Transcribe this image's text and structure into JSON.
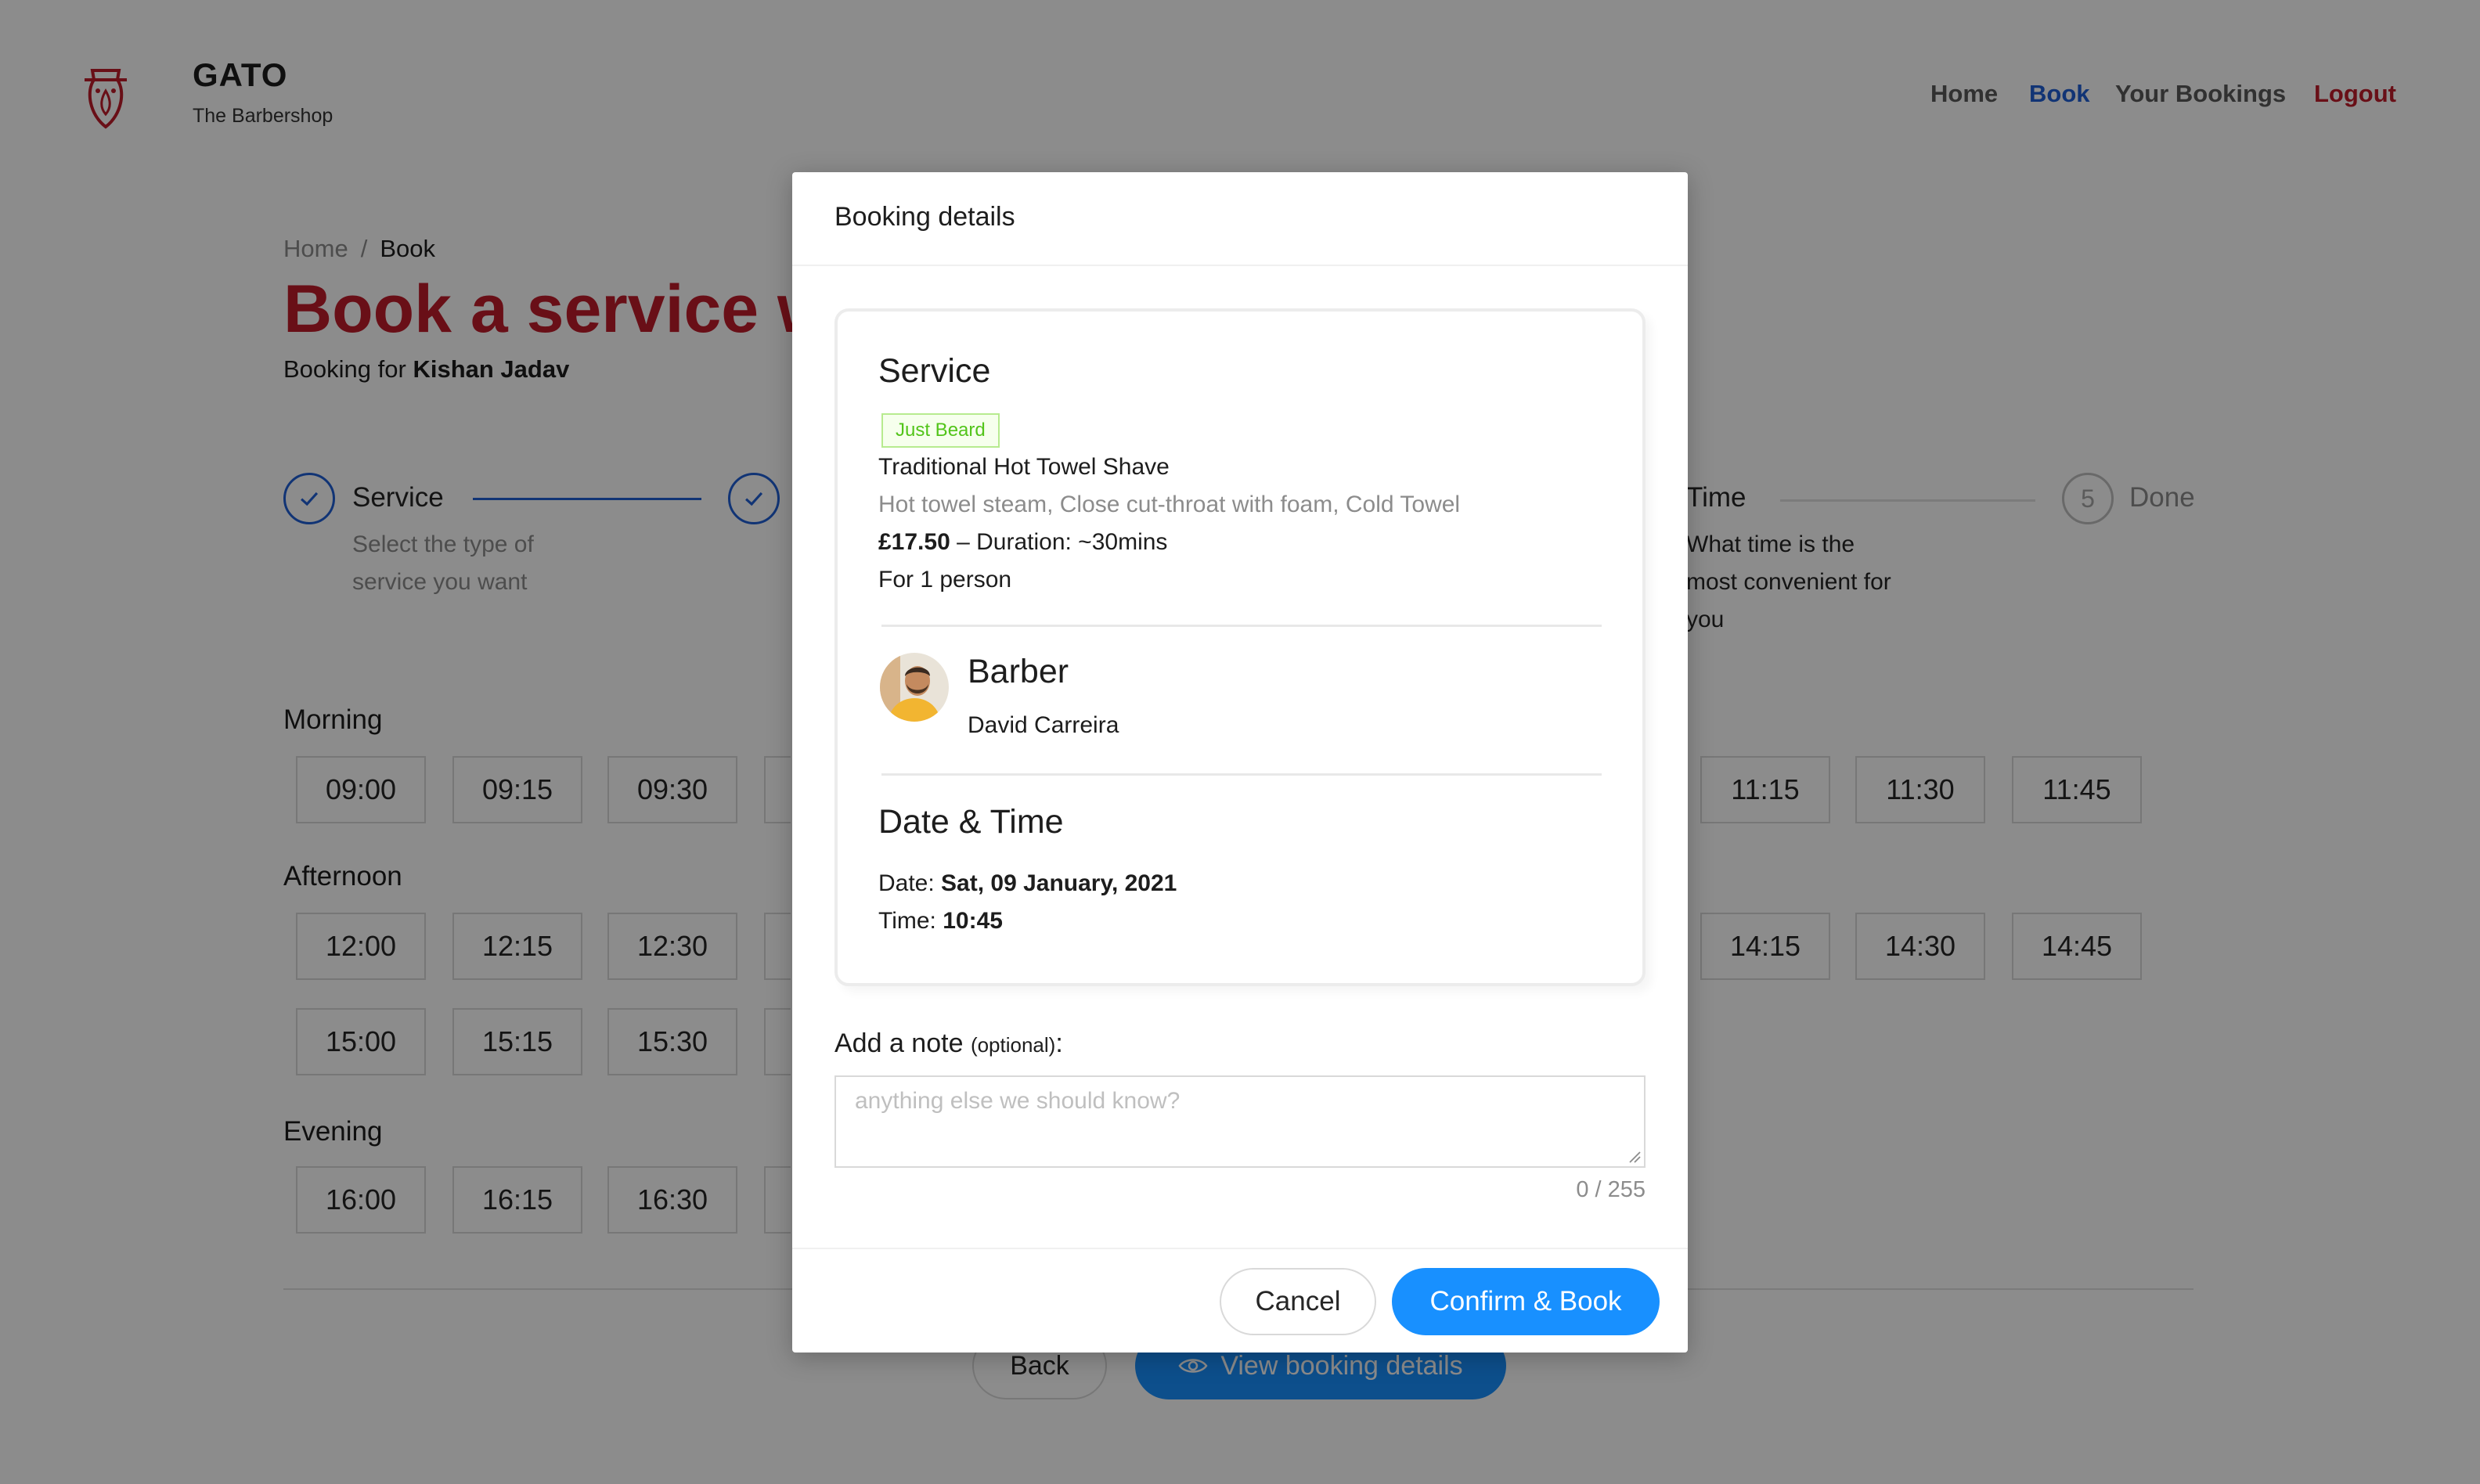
{
  "brand": {
    "title": "GATO",
    "subtitle": "The Barbershop"
  },
  "nav": {
    "items": [
      "Home",
      "Book",
      "Your Bookings",
      "Logout"
    ],
    "active": "Book"
  },
  "breadcrumb": {
    "home": "Home",
    "sep": "/",
    "current": "Book"
  },
  "page": {
    "title": "Book a service w",
    "booking_for_prefix": "Booking for",
    "customer_name": "Kishan Jadav"
  },
  "steps": [
    {
      "title": "Service",
      "desc1": "Select the type of",
      "desc2": "service you want",
      "state": "done"
    },
    {
      "title": "",
      "state": "done"
    },
    {
      "title": "Time",
      "desc1": "What time is the",
      "desc2": "most convenient for",
      "desc3": "you",
      "state": "current"
    },
    {
      "number": "5",
      "title": "Done",
      "state": "pending"
    }
  ],
  "slots": {
    "morning_label": "Morning",
    "morning_left": [
      "09:00",
      "09:15",
      "09:30"
    ],
    "morning_right": [
      "11:15",
      "11:30",
      "11:45"
    ],
    "afternoon_label": "Afternoon",
    "afternoon_left_1": [
      "12:00",
      "12:15",
      "12:30"
    ],
    "afternoon_right_1": [
      "14:15",
      "14:30",
      "14:45"
    ],
    "afternoon_left_2": [
      "15:00",
      "15:15",
      "15:30"
    ],
    "evening_label": "Evening",
    "evening_left": [
      "16:00",
      "16:15",
      "16:30"
    ]
  },
  "footer_buttons": {
    "back": "Back",
    "view": "View booking details"
  },
  "modal": {
    "title": "Booking details",
    "service_heading": "Service",
    "service_tag": "Just Beard",
    "service_name": "Traditional Hot Towel Shave",
    "service_desc": "Hot towel steam, Close cut-throat with foam, Cold Towel",
    "price": "£17.50",
    "duration": " – Duration: ~30mins",
    "persons": "For 1 person",
    "barber_heading": "Barber",
    "barber_name": "David Carreira",
    "datetime_heading": "Date & Time",
    "date_label": "Date: ",
    "date_value": "Sat, 09 January, 2021",
    "time_label": "Time: ",
    "time_value": "10:45",
    "note_label": "Add a note",
    "note_optional": "(optional)",
    "note_colon": ":",
    "note_placeholder": "anything else we should know?",
    "note_counter": "0 / 255",
    "cancel": "Cancel",
    "confirm": "Confirm & Book"
  },
  "colors": {
    "brand_red": "#c01c2a",
    "primary_blue": "#1890ff",
    "nav_active": "#1f5fd6",
    "tag_green": "#52c41a"
  }
}
